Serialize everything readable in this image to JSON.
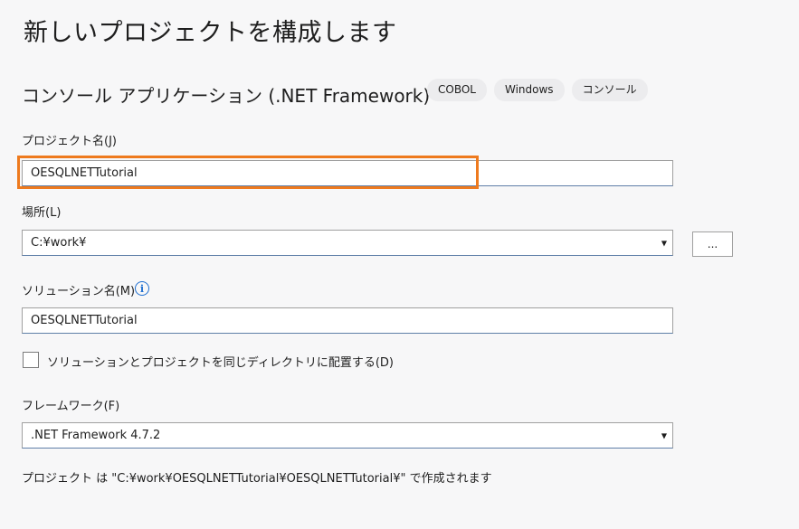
{
  "page_title": "新しいプロジェクトを構成します",
  "template": {
    "name": "コンソール アプリケーション (.NET Framework)",
    "tags": [
      "COBOL",
      "Windows",
      "コンソール"
    ]
  },
  "project_name": {
    "label": "プロジェクト名(J)",
    "value": "OESQLNETTutorial"
  },
  "location": {
    "label": "場所(L)",
    "value": "C:¥work¥",
    "browse_label": "..."
  },
  "solution_name": {
    "label": "ソリューション名(M)",
    "info_glyph": "i",
    "value": "OESQLNETTutorial"
  },
  "same_dir": {
    "label": "ソリューションとプロジェクトを同じディレクトリに配置する(D)",
    "checked": false
  },
  "framework": {
    "label": "フレームワーク(F)",
    "value": ".NET Framework 4.7.2"
  },
  "footer": "プロジェクト は \"C:¥work¥OESQLNETTutorial¥OESQLNETTutorial¥\" で作成されます",
  "colors": {
    "highlight": "#ee7a1e",
    "info": "#1f6fd0"
  }
}
